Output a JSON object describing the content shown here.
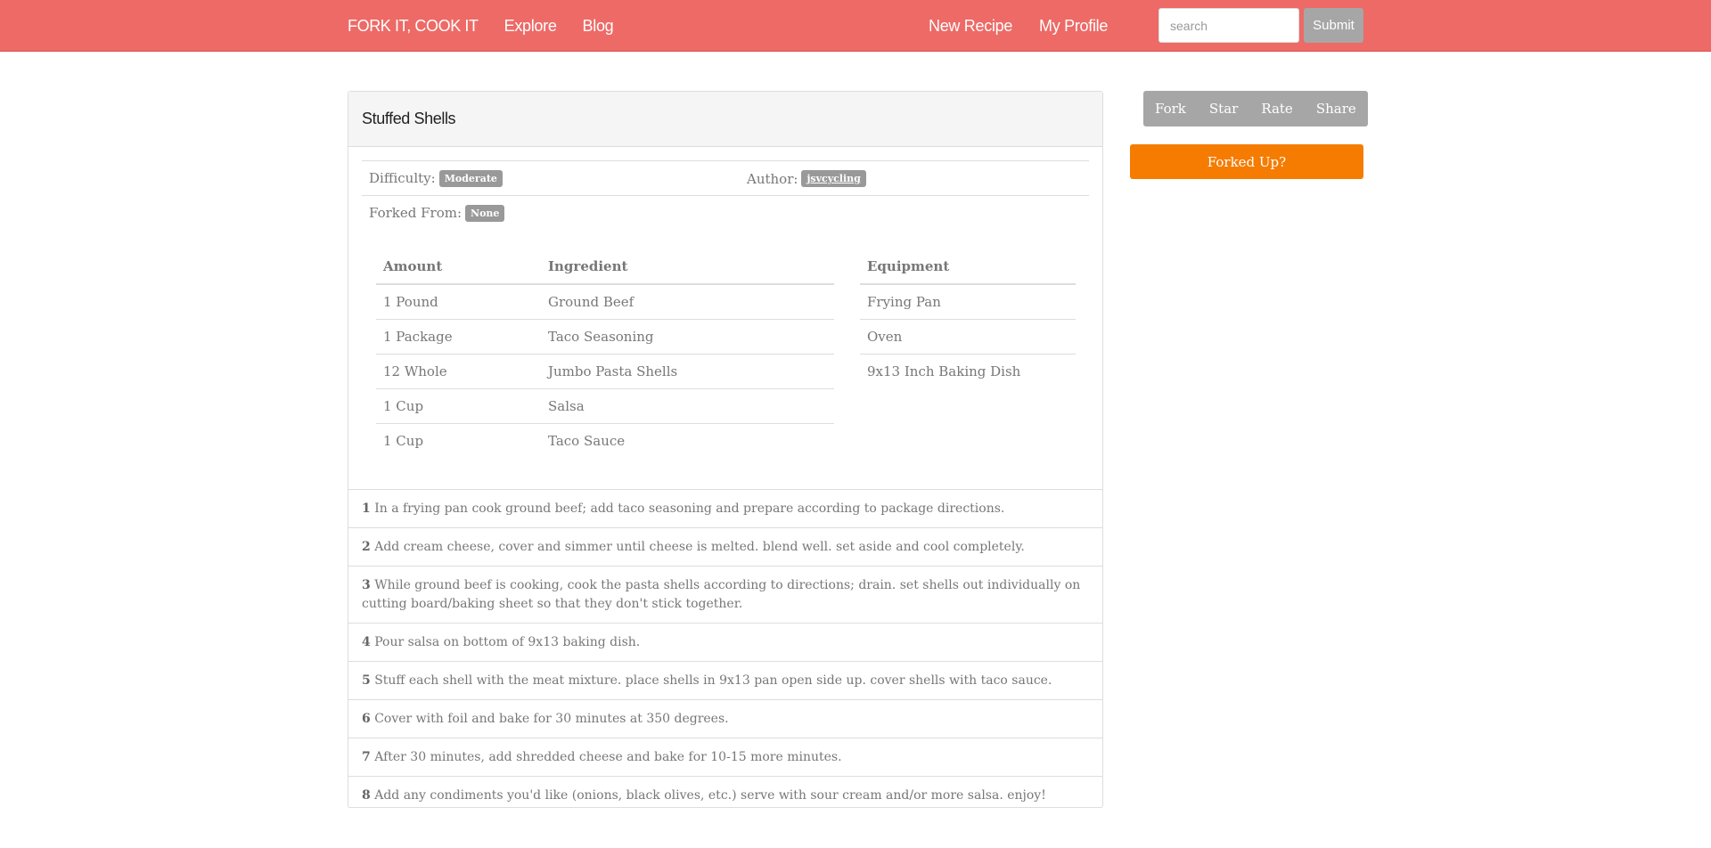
{
  "nav": {
    "brand": "FORK IT, COOK IT",
    "explore": "Explore",
    "blog": "Blog",
    "new_recipe": "New Recipe",
    "my_profile": "My Profile",
    "search_placeholder": "search",
    "submit": "Submit"
  },
  "recipe": {
    "title": "Stuffed Shells",
    "difficulty_label": "Difficulty:",
    "difficulty_value": "Moderate",
    "author_label": "Author:",
    "author_value": "jsvcycling",
    "forked_label": "Forked From:",
    "forked_value": "None"
  },
  "ingredients": {
    "headers": [
      "Amount",
      "Ingredient"
    ],
    "rows": [
      {
        "amount": "1 Pound",
        "name": "Ground Beef"
      },
      {
        "amount": "1 Package",
        "name": "Taco Seasoning"
      },
      {
        "amount": "12 Whole",
        "name": "Jumbo Pasta Shells"
      },
      {
        "amount": "1 Cup",
        "name": "Salsa"
      },
      {
        "amount": "1 Cup",
        "name": "Taco Sauce"
      }
    ]
  },
  "equipment": {
    "header": "Equipment",
    "rows": [
      "Frying Pan",
      "Oven",
      "9x13 Inch Baking Dish"
    ]
  },
  "steps": [
    {
      "num": "1",
      "text": "In a frying pan cook ground beef; add taco seasoning and prepare according to package directions."
    },
    {
      "num": "2",
      "text": "Add cream cheese, cover and simmer until cheese is melted. blend well. set aside and cool completely."
    },
    {
      "num": "3",
      "text": "While ground beef is cooking, cook the pasta shells according to directions; drain. set shells out individually on cutting board/baking sheet so that they don't stick together."
    },
    {
      "num": "4",
      "text": "Pour salsa on bottom of 9x13 baking dish."
    },
    {
      "num": "5",
      "text": "Stuff each shell with the meat mixture. place shells in 9x13 pan open side up. cover shells with taco sauce."
    },
    {
      "num": "6",
      "text": "Cover with foil and bake for 30 minutes at 350 degrees."
    },
    {
      "num": "7",
      "text": "After 30 minutes, add shredded cheese and bake for 10-15 more minutes."
    },
    {
      "num": "8",
      "text": "Add any condiments you'd like (onions, black olives, etc.) serve with sour cream and/or more salsa. enjoy!"
    }
  ],
  "sidebar": {
    "actions": [
      "Fork",
      "Star",
      "Rate",
      "Share"
    ],
    "forked_up": "Forked Up?"
  },
  "colors": {
    "navbar": "#ed6a66",
    "gray_button": "#a6a6a6",
    "orange_button": "#f57c00"
  }
}
